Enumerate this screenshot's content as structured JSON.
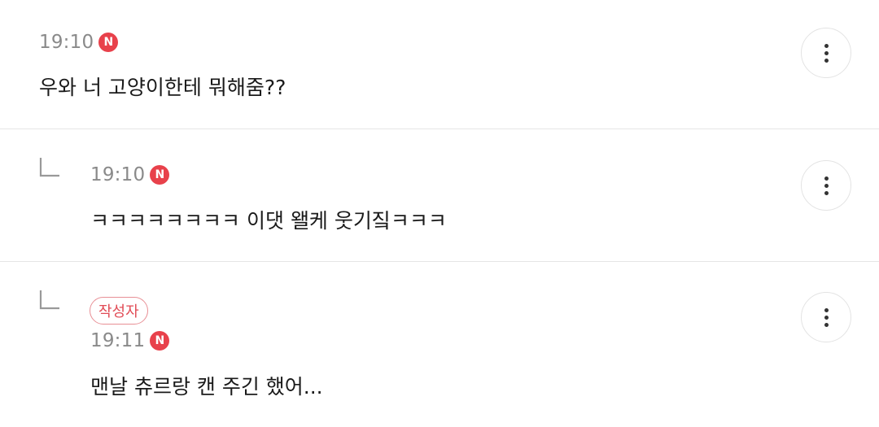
{
  "comments": [
    {
      "time": "19:10",
      "badge": "N",
      "text": "우와 너 고양이한테 뭐해줌??",
      "is_reply": false
    },
    {
      "time": "19:10",
      "badge": "N",
      "text": "ㅋㅋㅋㅋㅋㅋㅋㅋ 이댓 왤케 웃기짘ㅋㅋㅋ",
      "is_reply": true
    },
    {
      "author_label": "작성자",
      "time": "19:11",
      "badge": "N",
      "text": "맨날 츄르랑 캔 주긴 했어...",
      "is_reply": true
    }
  ],
  "icons": {
    "more": "more-vertical-icon",
    "reply": "reply-arrow-icon"
  },
  "colors": {
    "badge_red": "#e8414b",
    "author_border": "#e88f95",
    "author_text": "#e14b55",
    "time_gray": "#8a8a8a",
    "divider": "#e6e6e6"
  }
}
